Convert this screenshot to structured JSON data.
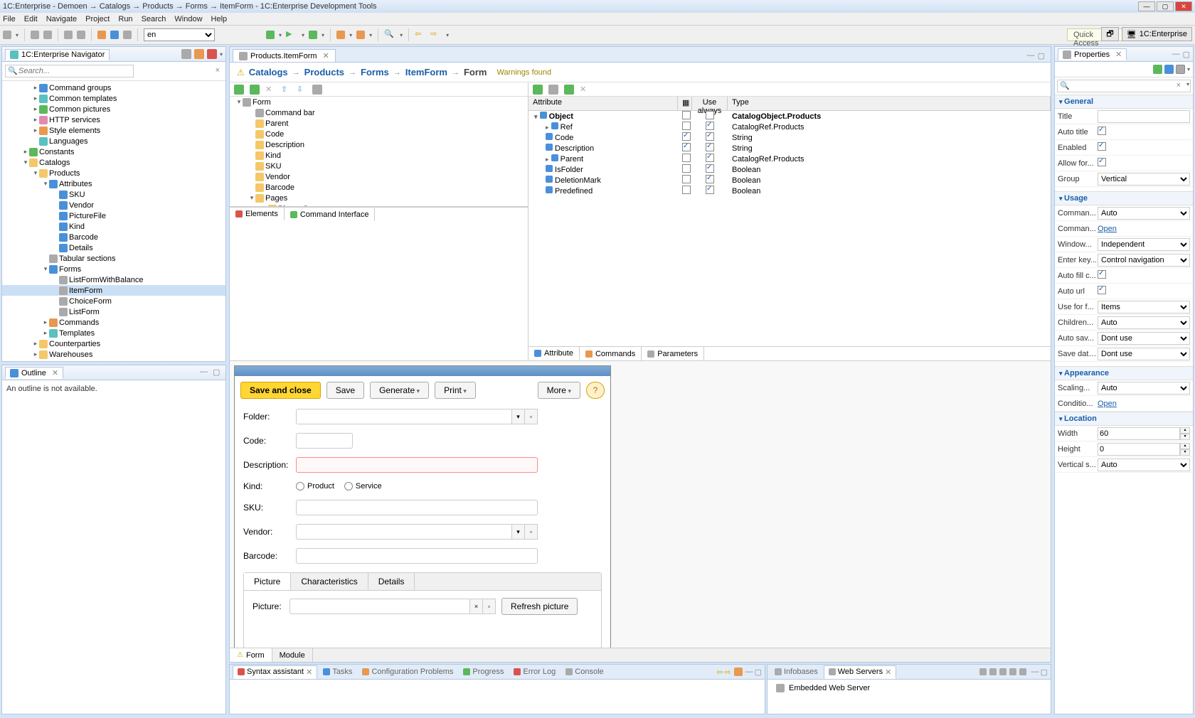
{
  "window": {
    "title": "1C:Enterprise - Demoen → Catalogs → Products → Forms → ItemForm - 1C:Enterprise Development Tools"
  },
  "menubar": [
    "File",
    "Edit",
    "Navigate",
    "Project",
    "Run",
    "Search",
    "Window",
    "Help"
  ],
  "toolbar": {
    "language": "en",
    "quick_access": "Quick Access",
    "perspective": "1C:Enterprise"
  },
  "navigator": {
    "title": "1C:Enterprise Navigator",
    "search_placeholder": "Search...",
    "tree": [
      {
        "indent": 3,
        "toggle": "▸",
        "icon": "icon-blue",
        "label": "Command groups"
      },
      {
        "indent": 3,
        "toggle": "▸",
        "icon": "icon-teal",
        "label": "Common templates"
      },
      {
        "indent": 3,
        "toggle": "▸",
        "icon": "icon-green",
        "label": "Common pictures"
      },
      {
        "indent": 3,
        "toggle": "▸",
        "icon": "icon-pink",
        "label": "HTTP services"
      },
      {
        "indent": 3,
        "toggle": "▸",
        "icon": "icon-orange",
        "label": "Style elements"
      },
      {
        "indent": 3,
        "toggle": "",
        "icon": "icon-teal",
        "label": "Languages"
      },
      {
        "indent": 2,
        "toggle": "▸",
        "icon": "icon-green",
        "label": "Constants"
      },
      {
        "indent": 2,
        "toggle": "▾",
        "icon": "icon-folder",
        "label": "Catalogs"
      },
      {
        "indent": 3,
        "toggle": "▾",
        "icon": "icon-folder",
        "label": "Products"
      },
      {
        "indent": 4,
        "toggle": "▾",
        "icon": "icon-blue",
        "label": "Attributes"
      },
      {
        "indent": 5,
        "toggle": "",
        "icon": "icon-blue",
        "label": "SKU"
      },
      {
        "indent": 5,
        "toggle": "",
        "icon": "icon-blue",
        "label": "Vendor"
      },
      {
        "indent": 5,
        "toggle": "",
        "icon": "icon-blue",
        "label": "PictureFile"
      },
      {
        "indent": 5,
        "toggle": "",
        "icon": "icon-blue",
        "label": "Kind"
      },
      {
        "indent": 5,
        "toggle": "",
        "icon": "icon-blue",
        "label": "Barcode"
      },
      {
        "indent": 5,
        "toggle": "",
        "icon": "icon-blue",
        "label": "Details"
      },
      {
        "indent": 4,
        "toggle": "",
        "icon": "icon-gray",
        "label": "Tabular sections"
      },
      {
        "indent": 4,
        "toggle": "▾",
        "icon": "icon-blue",
        "label": "Forms"
      },
      {
        "indent": 5,
        "toggle": "",
        "icon": "icon-gray",
        "label": "ListFormWithBalance"
      },
      {
        "indent": 5,
        "toggle": "",
        "icon": "icon-gray",
        "label": "ItemForm",
        "selected": true
      },
      {
        "indent": 5,
        "toggle": "",
        "icon": "icon-gray",
        "label": "ChoiceForm"
      },
      {
        "indent": 5,
        "toggle": "",
        "icon": "icon-gray",
        "label": "ListForm"
      },
      {
        "indent": 4,
        "toggle": "▸",
        "icon": "icon-orange",
        "label": "Commands"
      },
      {
        "indent": 4,
        "toggle": "▸",
        "icon": "icon-teal",
        "label": "Templates"
      },
      {
        "indent": 3,
        "toggle": "▸",
        "icon": "icon-folder",
        "label": "Counterparties"
      },
      {
        "indent": 3,
        "toggle": "▸",
        "icon": "icon-folder",
        "label": "Warehouses"
      }
    ]
  },
  "outline": {
    "title": "Outline",
    "empty_msg": "An outline is not available."
  },
  "editor": {
    "tab_title": "Products.ItemForm",
    "breadcrumb": [
      "Catalogs",
      "Products",
      "Forms",
      "ItemForm",
      "Form"
    ],
    "warnings": "Warnings found",
    "form_tree": [
      {
        "indent": 0,
        "toggle": "▾",
        "icon": "icon-gray",
        "label": "Form"
      },
      {
        "indent": 1,
        "toggle": "",
        "icon": "icon-gray",
        "label": "Command bar"
      },
      {
        "indent": 1,
        "toggle": "",
        "icon": "icon-folder",
        "label": "Parent"
      },
      {
        "indent": 1,
        "toggle": "",
        "icon": "icon-folder",
        "label": "Code"
      },
      {
        "indent": 1,
        "toggle": "",
        "icon": "icon-folder",
        "label": "Description"
      },
      {
        "indent": 1,
        "toggle": "",
        "icon": "icon-folder",
        "label": "Kind"
      },
      {
        "indent": 1,
        "toggle": "",
        "icon": "icon-folder",
        "label": "SKU"
      },
      {
        "indent": 1,
        "toggle": "",
        "icon": "icon-folder",
        "label": "Vendor"
      },
      {
        "indent": 1,
        "toggle": "",
        "icon": "icon-folder",
        "label": "Barcode"
      },
      {
        "indent": 1,
        "toggle": "▾",
        "icon": "icon-folder",
        "label": "Pages"
      },
      {
        "indent": 2,
        "toggle": "▸",
        "icon": "icon-folder",
        "label": "PictureGroup"
      }
    ],
    "sub_tabs_left": [
      "Elements",
      "Command Interface"
    ],
    "attr_header": {
      "attr": "Attribute",
      "use": "Use always",
      "type": "Type"
    },
    "attr_rows": [
      {
        "indent": 0,
        "toggle": "▾",
        "bold": true,
        "label": "Object",
        "c1": false,
        "c2": false,
        "type": "CatalogObject.Products"
      },
      {
        "indent": 1,
        "toggle": "▸",
        "label": "Ref",
        "c1": false,
        "c2": true,
        "type": "CatalogRef.Products"
      },
      {
        "indent": 1,
        "toggle": "",
        "label": "Code",
        "c1": true,
        "c2": true,
        "type": "String"
      },
      {
        "indent": 1,
        "toggle": "",
        "label": "Description",
        "c1": true,
        "c2": true,
        "type": "String"
      },
      {
        "indent": 1,
        "toggle": "▸",
        "label": "Parent",
        "c1": false,
        "c2": true,
        "type": "CatalogRef.Products"
      },
      {
        "indent": 1,
        "toggle": "",
        "label": "IsFolder",
        "c1": false,
        "c2": true,
        "type": "Boolean"
      },
      {
        "indent": 1,
        "toggle": "",
        "label": "DeletionMark",
        "c1": false,
        "c2": true,
        "type": "Boolean"
      },
      {
        "indent": 1,
        "toggle": "",
        "label": "Predefined",
        "c1": false,
        "c2": true,
        "type": "Boolean"
      }
    ],
    "sub_tabs_right": [
      "Attribute",
      "Commands",
      "Parameters"
    ],
    "preview": {
      "save_close": "Save and close",
      "save": "Save",
      "generate": "Generate",
      "print": "Print",
      "more": "More",
      "labels": {
        "folder": "Folder:",
        "code": "Code:",
        "description": "Description:",
        "kind": "Kind:",
        "sku": "SKU:",
        "vendor": "Vendor:",
        "barcode": "Barcode:",
        "picture": "Picture:"
      },
      "radio1": "Product",
      "radio2": "Service",
      "tabs": [
        "Picture",
        "Characteristics",
        "Details"
      ],
      "refresh": "Refresh picture"
    },
    "bottom_tabs": [
      "Form",
      "Module"
    ]
  },
  "bottom": {
    "left_tabs": [
      "Syntax assistant",
      "Tasks",
      "Configuration Problems",
      "Progress",
      "Error Log",
      "Console"
    ],
    "right_tabs": [
      "Infobases",
      "Web Servers"
    ],
    "right_item": "Embedded Web Server"
  },
  "properties": {
    "title": "Properties",
    "sections": [
      {
        "title": "General",
        "rows": [
          {
            "label": "Title",
            "type": "text",
            "value": ""
          },
          {
            "label": "Auto title",
            "type": "check",
            "value": true
          },
          {
            "label": "Enabled",
            "type": "check",
            "value": true
          },
          {
            "label": "Allow for...",
            "type": "check",
            "value": true
          },
          {
            "label": "Group",
            "type": "select",
            "value": "Vertical"
          }
        ]
      },
      {
        "title": "Usage",
        "rows": [
          {
            "label": "Comman...",
            "type": "select",
            "value": "Auto"
          },
          {
            "label": "Comman...",
            "type": "link",
            "value": "Open"
          },
          {
            "label": "Window...",
            "type": "select",
            "value": "Independent"
          },
          {
            "label": "Enter key...",
            "type": "select",
            "value": "Control navigation"
          },
          {
            "label": "Auto fill c...",
            "type": "check",
            "value": true
          },
          {
            "label": "Auto url",
            "type": "check",
            "value": true
          },
          {
            "label": "Use for f...",
            "type": "select",
            "value": "Items"
          },
          {
            "label": "Children...",
            "type": "select",
            "value": "Auto"
          },
          {
            "label": "Auto sav...",
            "type": "select",
            "value": "Dont use"
          },
          {
            "label": "Save data...",
            "type": "select",
            "value": "Dont use"
          }
        ]
      },
      {
        "title": "Appearance",
        "rows": [
          {
            "label": "Scaling...",
            "type": "select",
            "value": "Auto"
          },
          {
            "label": "Conditio...",
            "type": "link",
            "value": "Open"
          }
        ]
      },
      {
        "title": "Location",
        "rows": [
          {
            "label": "Width",
            "type": "spinner",
            "value": "60"
          },
          {
            "label": "Height",
            "type": "spinner",
            "value": "0"
          },
          {
            "label": "Vertical s...",
            "type": "select",
            "value": "Auto"
          }
        ]
      }
    ]
  }
}
